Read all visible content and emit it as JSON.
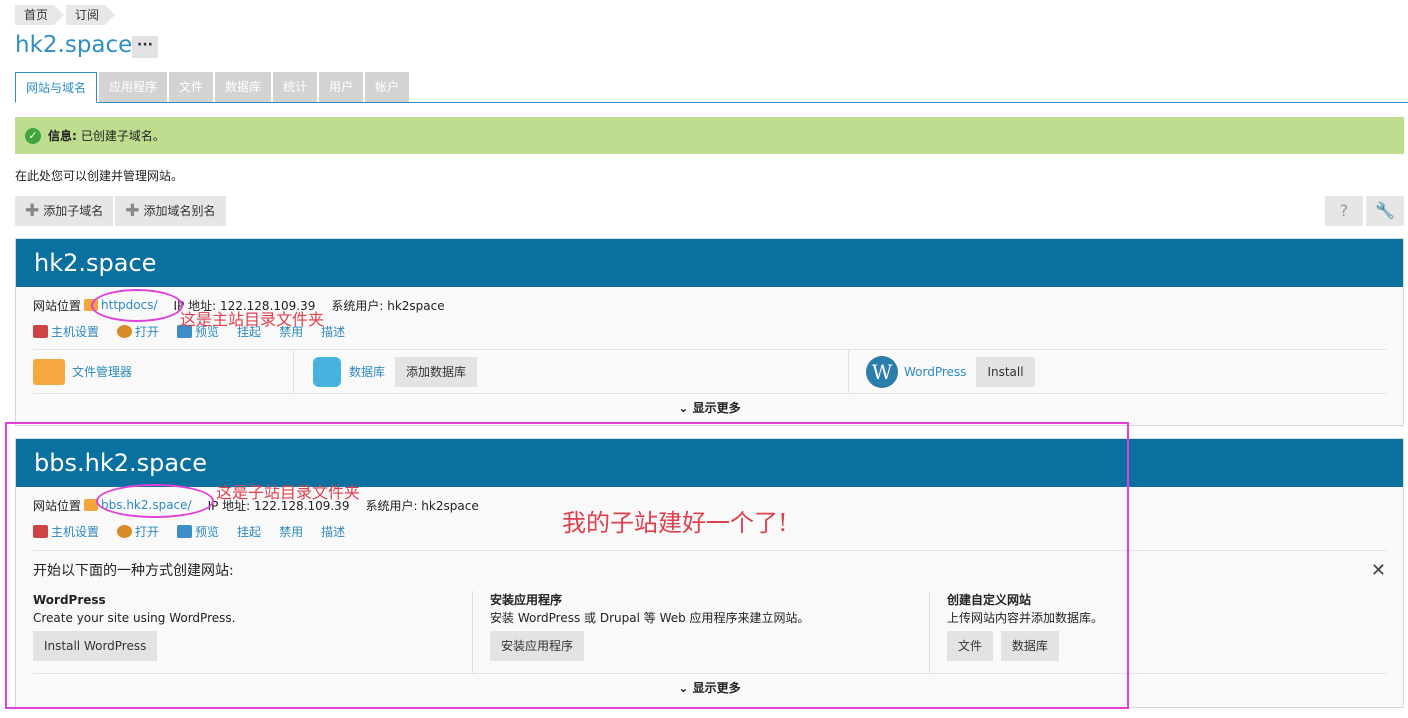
{
  "breadcrumb": [
    "首页",
    "订阅"
  ],
  "page_title": "hk2.space",
  "more_label": "···",
  "tabs": [
    "网站与域名",
    "应用程序",
    "文件",
    "数据库",
    "统计",
    "用户",
    "帐户"
  ],
  "info": {
    "label": "信息:",
    "message": "已创建子域名。"
  },
  "description": "在此处您可以创建并管理网站。",
  "toolbar": {
    "add_subdomain": "添加子域名",
    "add_alias": "添加域名别名"
  },
  "help_icon": "?",
  "settings_icon": "🔧",
  "site1": {
    "name": "hk2.space",
    "location_label": "网站位置",
    "folder": "httpdocs/",
    "ip": "IP 地址: 122.128.109.39",
    "sys_user": "系统用户: hk2space",
    "actions": [
      "主机设置",
      "打开",
      "预览",
      "挂起",
      "禁用",
      "描述"
    ],
    "file_manager": "文件管理器",
    "database": "数据库",
    "add_database": "添加数据库",
    "wordpress": "WordPress",
    "install": "Install",
    "show_more": "显示更多"
  },
  "site2": {
    "name": "bbs.hk2.space",
    "location_label": "网站位置",
    "folder": "bbs.hk2.space/",
    "ip": "IP 地址: 122.128.109.39",
    "sys_user": "系统用户: hk2space",
    "actions": [
      "主机设置",
      "打开",
      "预览",
      "挂起",
      "禁用",
      "描述"
    ],
    "start_title": "开始以下面的一种方式创建网站:",
    "close": "✕",
    "col1": {
      "title": "WordPress",
      "desc": "Create your site using WordPress.",
      "btn": "Install WordPress"
    },
    "col2": {
      "title": "安装应用程序",
      "desc": "安装 WordPress 或 Drupal 等 Web 应用程序来建立网站。",
      "btn": "安装应用程序"
    },
    "col3": {
      "title": "创建自定义网站",
      "desc": "上传网站内容并添加数据库。",
      "btn1": "文件",
      "btn2": "数据库"
    },
    "show_more": "显示更多"
  },
  "annotations": {
    "main_dir": "这是主站目录文件夹",
    "sub_dir": "这是子站目录文件夹",
    "done": "我的子站建好一个了!"
  }
}
